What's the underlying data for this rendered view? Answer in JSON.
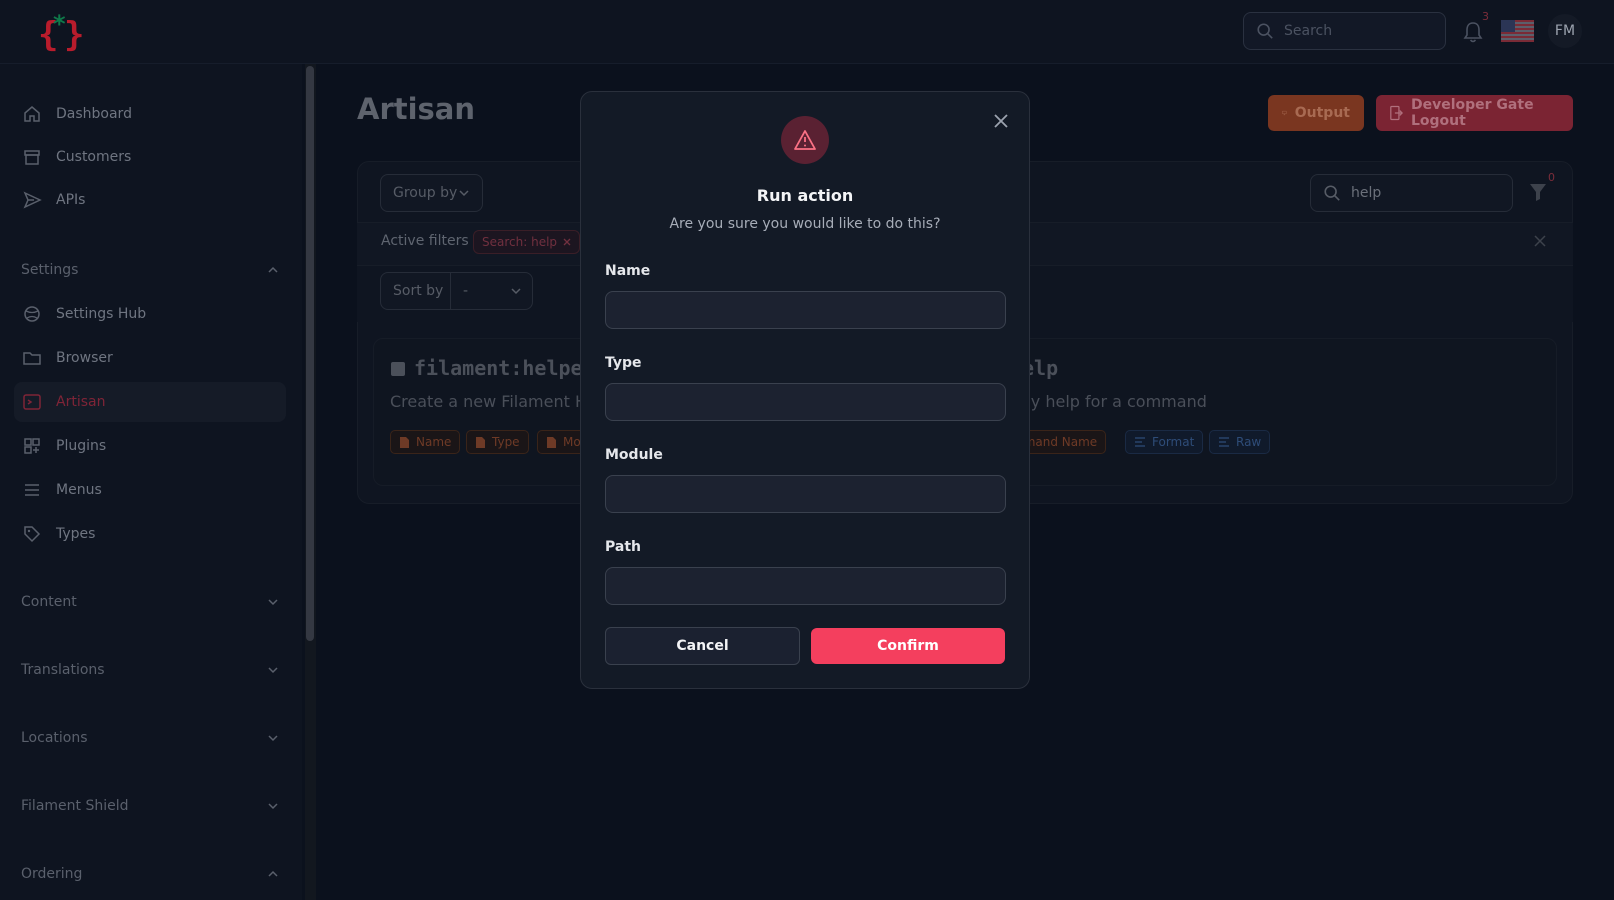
{
  "topbar": {
    "search_placeholder": "Search",
    "notification_count": "3",
    "avatar_initials": "FM"
  },
  "sidebar": {
    "items": [
      {
        "label": "Dashboard",
        "icon": "home-icon"
      },
      {
        "label": "Customers",
        "icon": "archive-icon"
      },
      {
        "label": "APIs",
        "icon": "send-icon"
      }
    ],
    "settings_group": {
      "label": "Settings",
      "items": [
        {
          "label": "Settings Hub",
          "icon": "globe-icon"
        },
        {
          "label": "Browser",
          "icon": "folder-icon"
        },
        {
          "label": "Artisan",
          "icon": "terminal-icon",
          "active": true
        },
        {
          "label": "Plugins",
          "icon": "puzzle-icon"
        },
        {
          "label": "Menus",
          "icon": "bars-icon"
        },
        {
          "label": "Types",
          "icon": "tag-icon"
        }
      ]
    },
    "groups": [
      "Content",
      "Translations",
      "Locations",
      "Filament Shield",
      "Ordering"
    ]
  },
  "main": {
    "title": "Artisan",
    "output_button": "Output",
    "logout_button": "Developer Gate Logout",
    "group_by": "Group by",
    "table_search_value": "help",
    "filter_count": "0",
    "active_filters_label": "Active filters",
    "filter_chip": "Search: help",
    "sort_by_label": "Sort by",
    "sort_by_value": "-",
    "cards": [
      {
        "title": "filament:helpe",
        "description": "Create a new Filament Help",
        "tags": [
          "Name",
          "Type",
          "Mo"
        ]
      },
      {
        "title": "elp",
        "description": "ay help for a command",
        "tags": [
          "mmand Name",
          "Format",
          "Raw"
        ]
      }
    ]
  },
  "modal": {
    "title": "Run action",
    "description": "Are you sure you would like to do this?",
    "fields": [
      {
        "label": "Name",
        "value": ""
      },
      {
        "label": "Type",
        "value": ""
      },
      {
        "label": "Module",
        "value": ""
      },
      {
        "label": "Path",
        "value": ""
      }
    ],
    "cancel_label": "Cancel",
    "confirm_label": "Confirm"
  },
  "colors": {
    "background": "#0b111d",
    "modal_bg": "#131a26",
    "confirm": "#f43f5e",
    "danger_icon_bg": "#5a2132"
  }
}
